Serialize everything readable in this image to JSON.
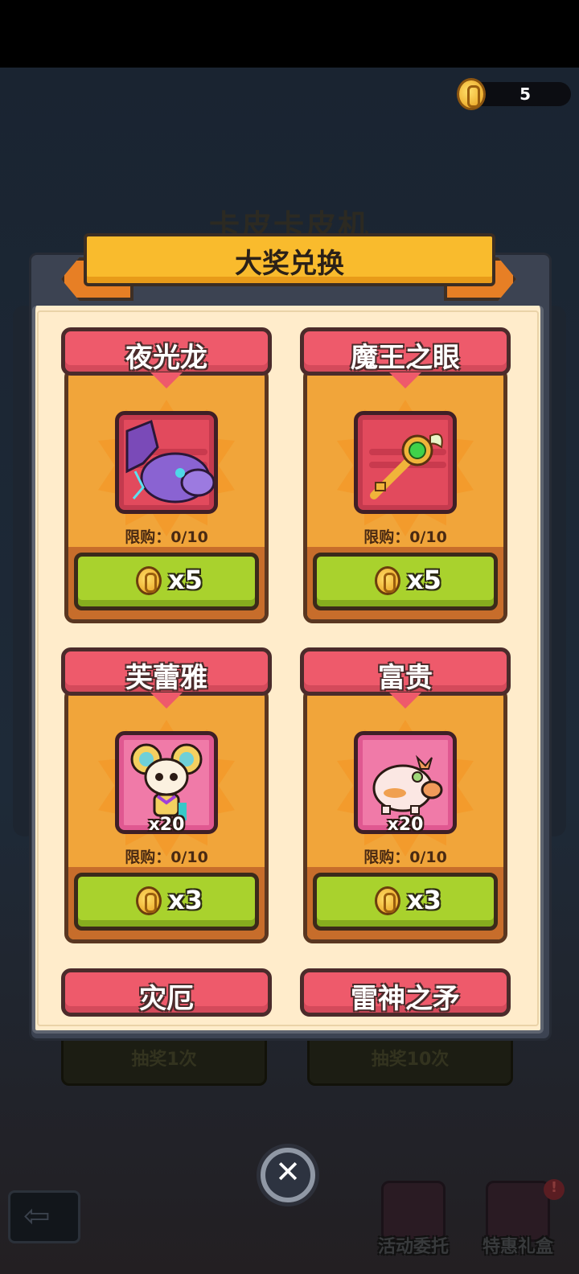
{
  "header": {
    "coin_count": "5"
  },
  "background": {
    "machine_title": "卡皮卡皮机",
    "draw_once_label": "抽奖1次",
    "draw_ten_label": "抽奖10次"
  },
  "dialog": {
    "title": "大奖兑换",
    "items": [
      {
        "name": "夜光龙",
        "limit": "限购：0/10",
        "price": "x5",
        "qty": "",
        "icon": "night-dragon"
      },
      {
        "name": "魔王之眼",
        "limit": "限购：0/10",
        "price": "x5",
        "qty": "",
        "icon": "demon-eye-key"
      },
      {
        "name": "芙蕾雅",
        "limit": "限购：0/10",
        "price": "x3",
        "qty": "x20",
        "icon": "freya-cat"
      },
      {
        "name": "富贵",
        "limit": "限购：0/10",
        "price": "x3",
        "qty": "x20",
        "icon": "lucky-pig"
      },
      {
        "name": "灾厄",
        "icon": "calamity"
      },
      {
        "name": "雷神之矛",
        "icon": "thunder-spear"
      }
    ]
  },
  "dock": {
    "activity_label": "活动委托",
    "gift_label": "特惠礼盒",
    "gift_alert": "!"
  },
  "colors": {
    "accent": "#f9bb2d",
    "card_header": "#ee5a6b",
    "buy_button": "#a9d22d"
  }
}
